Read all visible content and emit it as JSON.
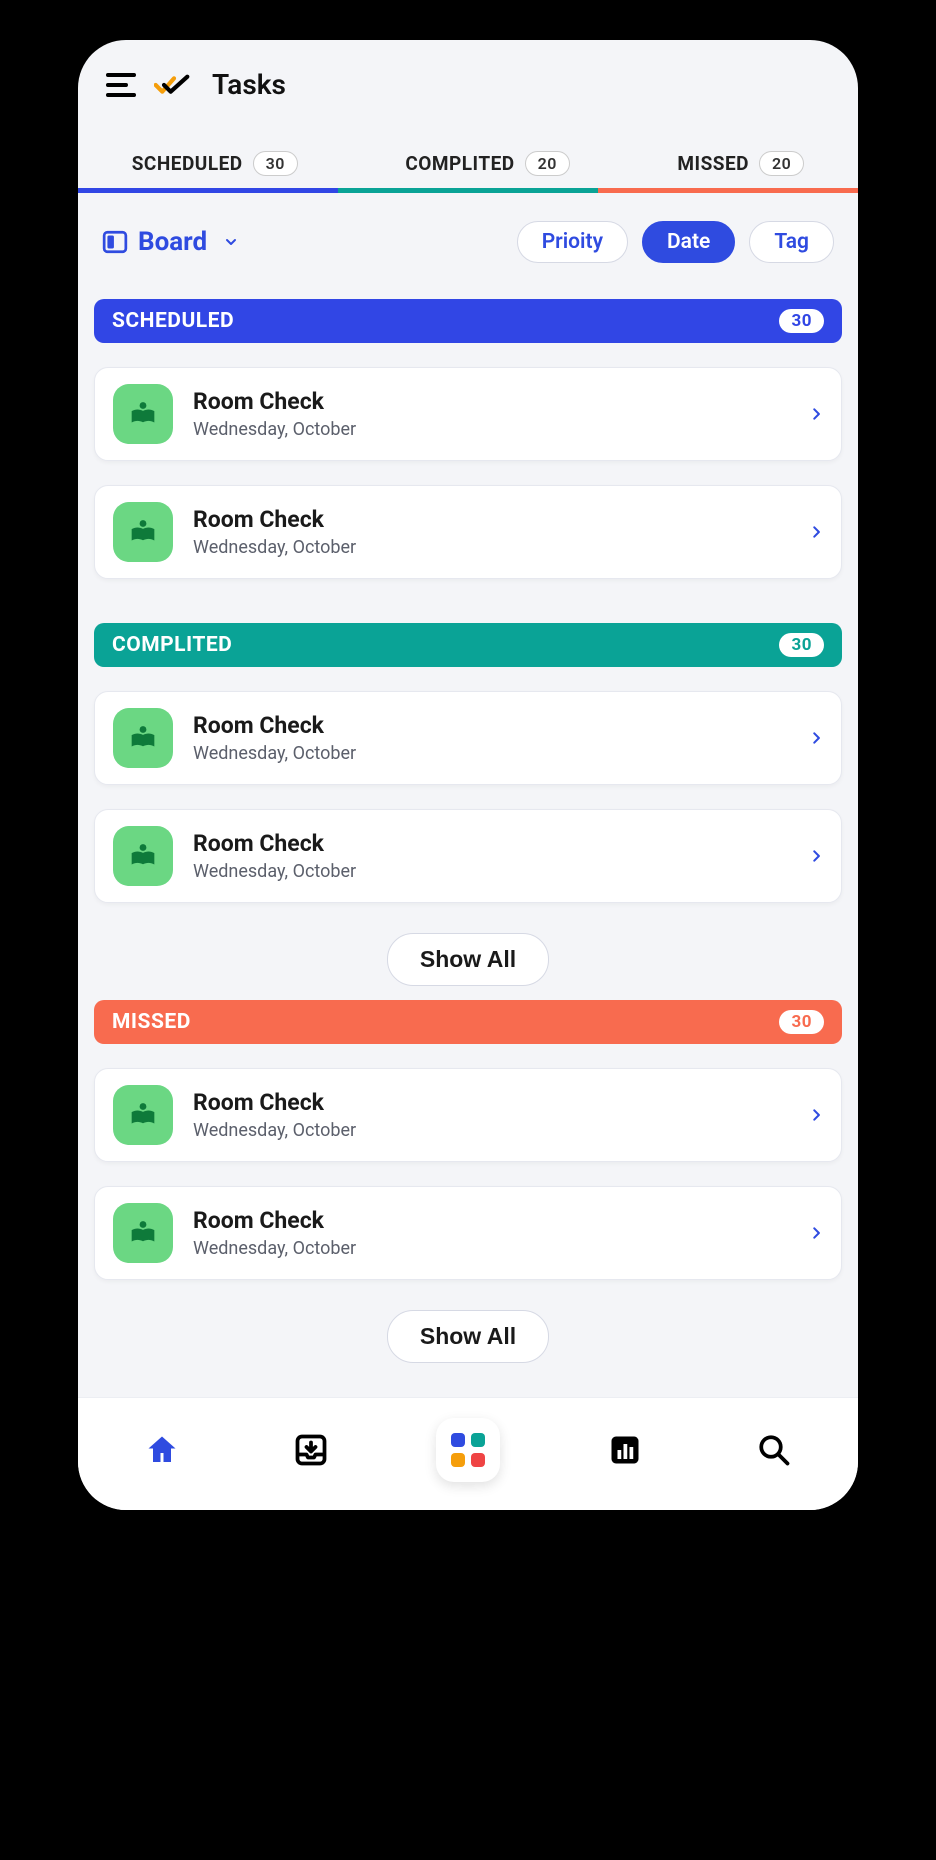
{
  "header": {
    "title": "Tasks"
  },
  "tabs": {
    "scheduled": {
      "label": "SCHEDULED",
      "count": "30"
    },
    "completed": {
      "label": "COMPLITED",
      "count": "20"
    },
    "missed": {
      "label": "MISSED",
      "count": "20"
    }
  },
  "view": {
    "label": "Board"
  },
  "filters": {
    "priority": "Prioity",
    "date": "Date",
    "tag": "Tag"
  },
  "sections": {
    "scheduled": {
      "label": "SCHEDULED",
      "count": "30",
      "items": [
        {
          "title": "Room Check",
          "sub": "Wednesday, October"
        },
        {
          "title": "Room Check",
          "sub": "Wednesday, October"
        }
      ]
    },
    "completed": {
      "label": "COMPLITED",
      "count": "30",
      "items": [
        {
          "title": "Room Check",
          "sub": "Wednesday, October"
        },
        {
          "title": "Room Check",
          "sub": "Wednesday, October"
        }
      ],
      "showAll": "Show All"
    },
    "missed": {
      "label": "MISSED",
      "count": "30",
      "items": [
        {
          "title": "Room Check",
          "sub": "Wednesday, October"
        },
        {
          "title": "Room Check",
          "sub": "Wednesday, October"
        }
      ],
      "showAll": "Show All"
    }
  }
}
